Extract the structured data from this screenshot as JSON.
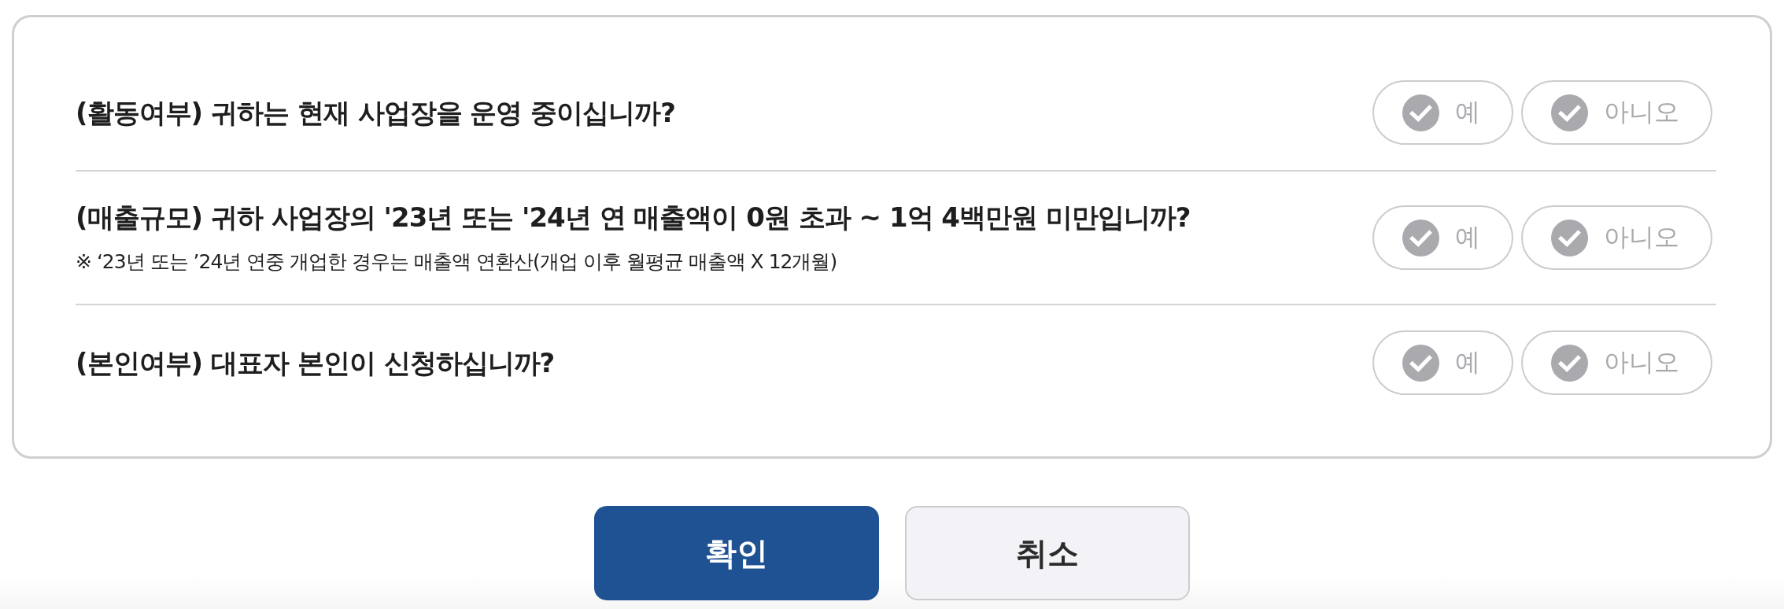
{
  "questions": [
    {
      "text": "(활동여부) 귀하는 현재 사업장을 운영 중이십니까?",
      "options": [
        {
          "label": "예",
          "selected": false
        },
        {
          "label": "아니오",
          "selected": false
        }
      ]
    },
    {
      "text": "(매출규모) 귀하 사업장의 '23년 또는 '24년 연 매출액이 0원 초과 ~ 1억 4백만원 미만입니까?",
      "note": "※ ‘23년 또는 ’24년 연중 개업한 경우는 매출액 연환산(개업 이후 월평균 매출액 X 12개월)",
      "options": [
        {
          "label": "예",
          "selected": false
        },
        {
          "label": "아니오",
          "selected": false
        }
      ]
    },
    {
      "text": "(본인여부) 대표자 본인이 신청하십니까?",
      "options": [
        {
          "label": "예",
          "selected": false
        },
        {
          "label": "아니오",
          "selected": false
        }
      ]
    }
  ],
  "buttons": [
    {
      "label": "확인",
      "kind": "primary"
    },
    {
      "label": "취소",
      "kind": "secondary"
    }
  ]
}
